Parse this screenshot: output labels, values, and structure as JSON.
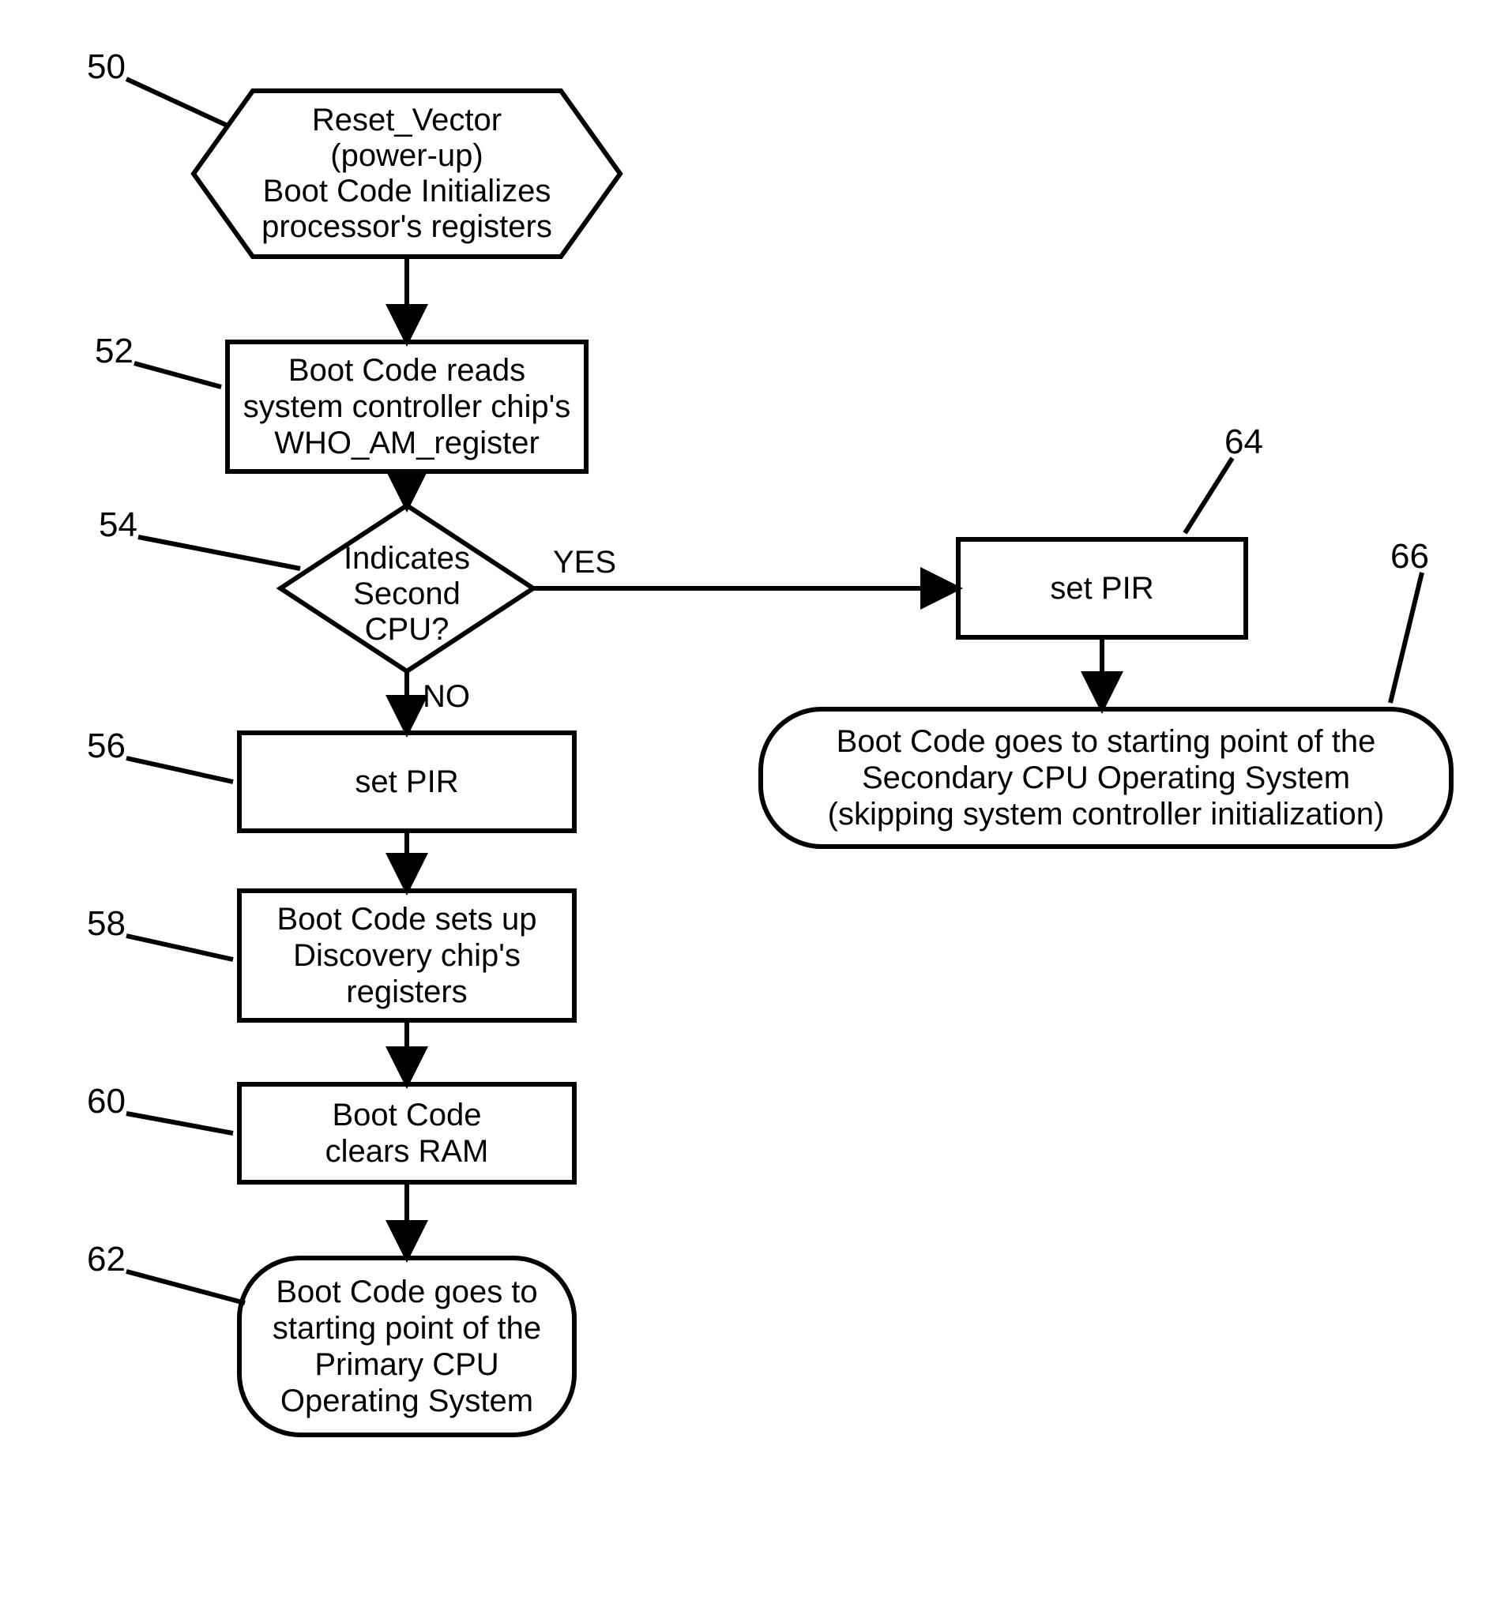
{
  "chart_data": {
    "type": "flowchart",
    "title": "",
    "nodes": [
      {
        "id": "n50",
        "ref": "50",
        "type": "preparation",
        "text": "Reset_Vector\n(power-up)\nBoot Code Initializes\nprocessor's registers"
      },
      {
        "id": "n52",
        "ref": "52",
        "type": "process",
        "text": "Boot Code reads\nsystem controller chip's\nWHO_AM_register"
      },
      {
        "id": "n54",
        "ref": "54",
        "type": "decision",
        "text": "Indicates\nSecond\nCPU?"
      },
      {
        "id": "n56",
        "ref": "56",
        "type": "process",
        "text": "set PIR"
      },
      {
        "id": "n58",
        "ref": "58",
        "type": "process",
        "text": "Boot Code sets up\nDiscovery chip's\nregisters"
      },
      {
        "id": "n60",
        "ref": "60",
        "type": "process",
        "text": "Boot Code\nclears RAM"
      },
      {
        "id": "n62",
        "ref": "62",
        "type": "terminator",
        "text": "Boot Code goes to\nstarting point of the\nPrimary CPU\nOperating System"
      },
      {
        "id": "n64",
        "ref": "64",
        "type": "process",
        "text": "set PIR"
      },
      {
        "id": "n66",
        "ref": "66",
        "type": "terminator",
        "text": "Boot Code goes to starting point of the\nSecondary CPU Operating System\n(skipping system controller initialization)"
      }
    ],
    "edges": [
      {
        "from": "n50",
        "to": "n52"
      },
      {
        "from": "n52",
        "to": "n54"
      },
      {
        "from": "n54",
        "to": "n56",
        "label": "NO"
      },
      {
        "from": "n54",
        "to": "n64",
        "label": "YES"
      },
      {
        "from": "n56",
        "to": "n58"
      },
      {
        "from": "n58",
        "to": "n60"
      },
      {
        "from": "n60",
        "to": "n62"
      },
      {
        "from": "n64",
        "to": "n66"
      }
    ]
  },
  "labels": {
    "yes": "YES",
    "no": "NO"
  },
  "node_text": {
    "n50": "Reset_Vector\n(power-up)\nBoot Code Initializes\nprocessor's registers",
    "n52": "Boot Code reads\nsystem controller chip's\nWHO_AM_register",
    "n54_l1": "Indicates",
    "n54_l2": "Second",
    "n54_l3": "CPU?",
    "n56": "set PIR",
    "n58": "Boot Code sets up\nDiscovery chip's\nregisters",
    "n60": "Boot Code\nclears RAM",
    "n62": "Boot Code goes to\nstarting point of the\nPrimary CPU\nOperating System",
    "n64": "set PIR",
    "n66": "Boot Code goes to starting point of the\nSecondary CPU Operating System\n(skipping system controller initialization)"
  },
  "refs": {
    "r50": "50",
    "r52": "52",
    "r54": "54",
    "r56": "56",
    "r58": "58",
    "r60": "60",
    "r62": "62",
    "r64": "64",
    "r66": "66"
  }
}
